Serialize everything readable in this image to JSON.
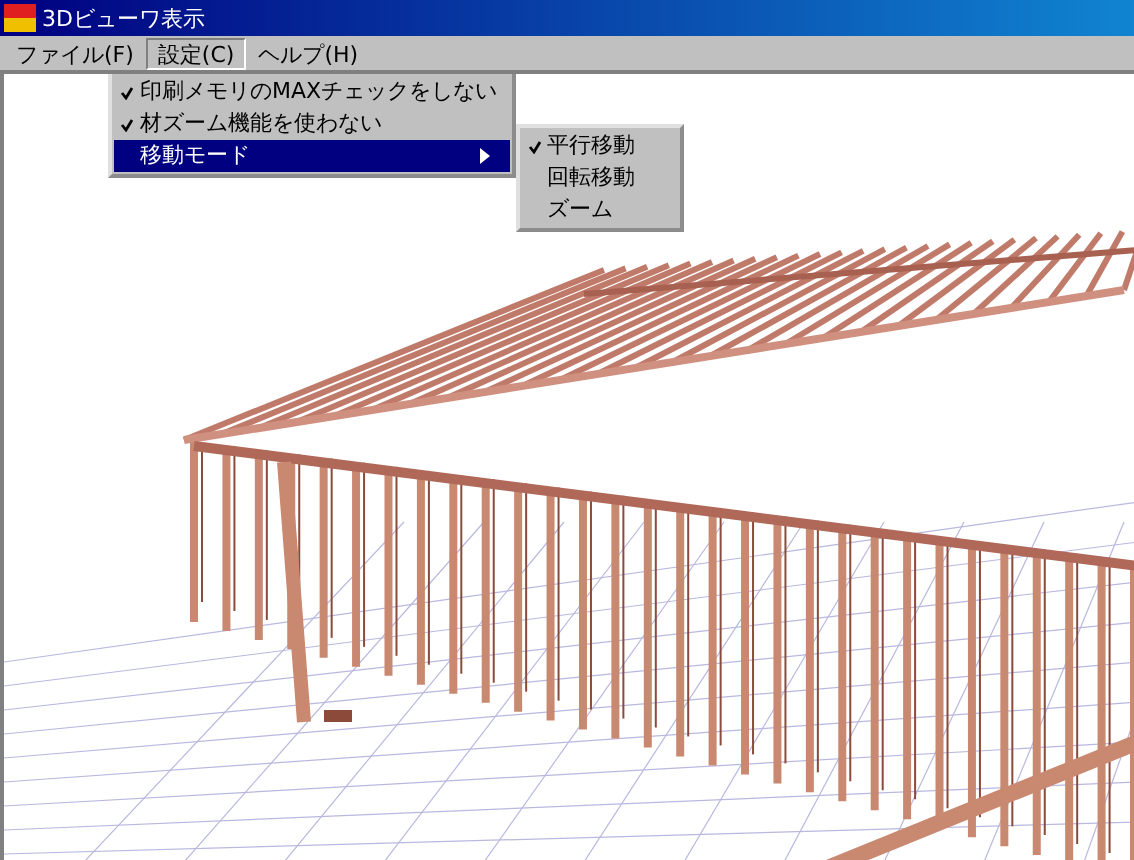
{
  "window": {
    "title": "3Dビューワ表示"
  },
  "menu_bar": [
    {
      "label": "ファイル(F)",
      "selected": false
    },
    {
      "label": "設定(C)",
      "selected": true
    },
    {
      "label": "ヘルプ(H)",
      "selected": false
    }
  ],
  "settings_menu": [
    {
      "kind": "check",
      "label": "印刷メモリのMAXチェックをしない",
      "checked": true,
      "selected": false
    },
    {
      "kind": "check",
      "label": "材ズーム機能を使わない",
      "checked": true,
      "selected": false
    },
    {
      "kind": "submenu",
      "label": "移動モード",
      "selected": true
    }
  ],
  "move_mode_submenu": [
    {
      "label": "平行移動",
      "checked": true
    },
    {
      "label": "回転移動",
      "checked": false
    },
    {
      "label": "ズーム",
      "checked": false
    }
  ]
}
